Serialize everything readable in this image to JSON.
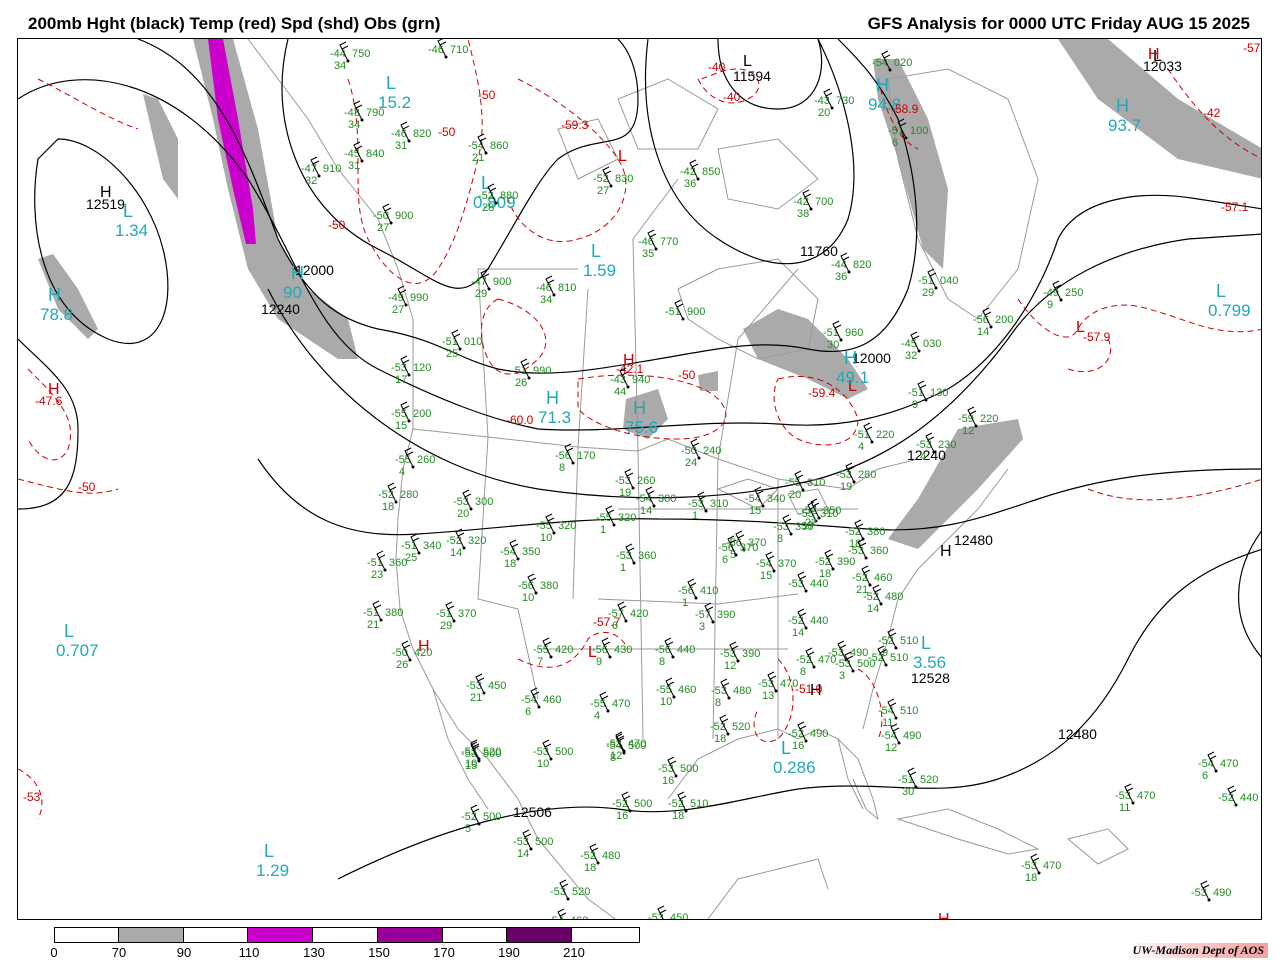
{
  "header": {
    "title_left": "200mb Hght (black) Temp (red) Spd (shd) Obs (grn)",
    "title_right": "GFS Analysis for 0000 UTC Friday  AUG 15 2025"
  },
  "colors": {
    "height_contour": "#000000",
    "temp_contour": "#cc0000",
    "obs": "#228b22",
    "speed_label": "#20a8b8",
    "geography": "#999999",
    "shade_70_90": "#aaaaaa",
    "shade_110_130": "#cc00cc",
    "shade_150_170": "#990099",
    "shade_190_210": "#660066"
  },
  "height_labels": [
    {
      "text": "12519"
    },
    {
      "text": "12000"
    },
    {
      "text": "12240"
    },
    {
      "text": "11594"
    },
    {
      "text": "11760"
    },
    {
      "text": "12000"
    },
    {
      "text": "12240"
    },
    {
      "text": "12480"
    },
    {
      "text": "12528"
    },
    {
      "text": "12480"
    },
    {
      "text": "12506"
    },
    {
      "text": "12033"
    }
  ],
  "center_markers": [
    {
      "letter": "H",
      "kind": "height"
    },
    {
      "letter": "L",
      "kind": "height"
    },
    {
      "letter": "H",
      "kind": "height"
    },
    {
      "letter": "L",
      "kind": "height"
    },
    {
      "letter": "H",
      "kind": "height"
    },
    {
      "letter": "H",
      "kind": "temp"
    },
    {
      "letter": "L",
      "kind": "temp"
    },
    {
      "letter": "H",
      "kind": "temp"
    },
    {
      "letter": "L",
      "kind": "temp"
    },
    {
      "letter": "H",
      "kind": "temp"
    },
    {
      "letter": "L",
      "kind": "temp"
    },
    {
      "letter": "H",
      "kind": "temp"
    },
    {
      "letter": "H",
      "kind": "temp"
    },
    {
      "letter": "L",
      "kind": "temp"
    }
  ],
  "speed_centers": [
    {
      "letter": "L",
      "value": "1.34"
    },
    {
      "letter": "H",
      "value": "78.8"
    },
    {
      "letter": "L",
      "value": "0.707"
    },
    {
      "letter": "L",
      "value": "1.29"
    },
    {
      "letter": "L",
      "value": "0.809"
    },
    {
      "letter": "L",
      "value": "1.59"
    },
    {
      "letter": "H",
      "value": "71.3"
    },
    {
      "letter": "H",
      "value": "75.6"
    },
    {
      "letter": "H",
      "value": "94.8"
    },
    {
      "letter": "H",
      "value": "93.7"
    },
    {
      "letter": "L",
      "value": "0.799"
    },
    {
      "letter": "H",
      "value": "49.1"
    },
    {
      "letter": "L",
      "value": "3.56"
    },
    {
      "letter": "L",
      "value": "0.286"
    },
    {
      "letter": "H",
      "value": "90"
    },
    {
      "letter": "L",
      "value": "15.2"
    }
  ],
  "temp_labels": [
    {
      "text": "-50"
    },
    {
      "text": "-50"
    },
    {
      "text": "-50"
    },
    {
      "text": "-50"
    },
    {
      "text": "-50"
    },
    {
      "text": "-40"
    },
    {
      "text": "-40"
    },
    {
      "text": "-59.3"
    },
    {
      "text": "-58.9"
    },
    {
      "text": "-57.1"
    },
    {
      "text": "-57.9"
    },
    {
      "text": "-59.4"
    },
    {
      "text": "-60.0"
    },
    {
      "text": "-42.1"
    },
    {
      "text": "-47.6"
    },
    {
      "text": "-57.7"
    },
    {
      "text": "-51.0"
    },
    {
      "text": "-57"
    },
    {
      "text": "-42"
    },
    {
      "text": "-53"
    }
  ],
  "observations": [
    {
      "t": "-44",
      "h": "750",
      "s": "34"
    },
    {
      "t": "-46",
      "h": "710",
      "s": ""
    },
    {
      "t": "-43",
      "h": "790",
      "s": "34"
    },
    {
      "t": "-46",
      "h": "820",
      "s": "31"
    },
    {
      "t": "-45",
      "h": "840",
      "s": "31"
    },
    {
      "t": "-47",
      "h": "910",
      "s": "32"
    },
    {
      "t": "-50",
      "h": "900",
      "s": "27"
    },
    {
      "t": "-54",
      "h": "860",
      "s": "21"
    },
    {
      "t": "-52",
      "h": "880",
      "s": "28"
    },
    {
      "t": "-52",
      "h": "830",
      "s": "27"
    },
    {
      "t": "-42",
      "h": "850",
      "s": "36"
    },
    {
      "t": "-43",
      "h": "730",
      "s": "20"
    },
    {
      "t": "-54",
      "h": "020",
      "s": ""
    },
    {
      "t": "-51",
      "h": "100",
      "s": "6"
    },
    {
      "t": "-42",
      "h": "700",
      "s": "38"
    },
    {
      "t": "-44",
      "h": "820",
      "s": "36"
    },
    {
      "t": "-46",
      "h": "770",
      "s": "35"
    },
    {
      "t": "-47",
      "h": "900",
      "s": "29"
    },
    {
      "t": "-46",
      "h": "810",
      "s": "34"
    },
    {
      "t": "-49",
      "h": "990",
      "s": "27"
    },
    {
      "t": "-51",
      "h": "010",
      "s": "25"
    },
    {
      "t": "-51",
      "h": "900",
      "s": ""
    },
    {
      "t": "-51",
      "h": "040",
      "s": "29"
    },
    {
      "t": "-49",
      "h": "250",
      "s": "9"
    },
    {
      "t": "-56",
      "h": "200",
      "s": "14"
    },
    {
      "t": "-51",
      "h": "960",
      "s": "30"
    },
    {
      "t": "-45",
      "h": "030",
      "s": "32"
    },
    {
      "t": "-53",
      "h": "120",
      "s": "17"
    },
    {
      "t": "-51",
      "h": "990",
      "s": "26"
    },
    {
      "t": "-43",
      "h": "940",
      "s": "44"
    },
    {
      "t": "-51",
      "h": "130",
      "s": "9"
    },
    {
      "t": "-55",
      "h": "200",
      "s": "15"
    },
    {
      "t": "-59",
      "h": "220",
      "s": "12"
    },
    {
      "t": "-55",
      "h": "260",
      "s": "4"
    },
    {
      "t": "-56",
      "h": "170",
      "s": "8"
    },
    {
      "t": "-50",
      "h": "240",
      "s": "24"
    },
    {
      "t": "-51",
      "h": "220",
      "s": "4"
    },
    {
      "t": "-53",
      "h": "230",
      "s": "4"
    },
    {
      "t": "-52",
      "h": "280",
      "s": "18"
    },
    {
      "t": "-53",
      "h": "300",
      "s": "20"
    },
    {
      "t": "-53",
      "h": "260",
      "s": "19"
    },
    {
      "t": "-54",
      "h": "300",
      "s": "14"
    },
    {
      "t": "-53",
      "h": "310",
      "s": "1"
    },
    {
      "t": "-54",
      "h": "340",
      "s": "15"
    },
    {
      "t": "-55",
      "h": "310",
      "s": "20"
    },
    {
      "t": "-53",
      "h": "280",
      "s": "19"
    },
    {
      "t": "-53",
      "h": "350",
      "s": "8"
    },
    {
      "t": "-53",
      "h": "310",
      "s": "17"
    },
    {
      "t": "-55",
      "h": "320",
      "s": "10"
    },
    {
      "t": "-55",
      "h": "320",
      "s": "1"
    },
    {
      "t": "-52",
      "h": "350",
      "s": "22"
    },
    {
      "t": "-52",
      "h": "380",
      "s": "18"
    },
    {
      "t": "-51",
      "h": "340",
      "s": "25"
    },
    {
      "t": "-52",
      "h": "320",
      "s": "14"
    },
    {
      "t": "-54",
      "h": "350",
      "s": "18"
    },
    {
      "t": "-51",
      "h": "360",
      "s": "23"
    },
    {
      "t": "-56",
      "h": "370",
      "s": "5"
    },
    {
      "t": "-53",
      "h": "360",
      "s": "1"
    },
    {
      "t": "-56",
      "h": "370",
      "s": "6"
    },
    {
      "t": "-54",
      "h": "370",
      "s": "15"
    },
    {
      "t": "-52",
      "h": "390",
      "s": "18"
    },
    {
      "t": "-52",
      "h": "460",
      "s": "21"
    },
    {
      "t": "-56",
      "h": "380",
      "s": "10"
    },
    {
      "t": "-56",
      "h": "410",
      "s": "1"
    },
    {
      "t": "-51",
      "h": "380",
      "s": "21"
    },
    {
      "t": "-51",
      "h": "370",
      "s": "29"
    },
    {
      "t": "-57",
      "h": "420",
      "s": "6"
    },
    {
      "t": "-57",
      "h": "390",
      "s": "3"
    },
    {
      "t": "-52",
      "h": "440",
      "s": "14"
    },
    {
      "t": "-52",
      "h": "480",
      "s": "14"
    },
    {
      "t": "-52",
      "h": "510",
      "s": "9"
    },
    {
      "t": "-52",
      "h": "510",
      "s": ""
    },
    {
      "t": "-50",
      "h": "420",
      "s": "26"
    },
    {
      "t": "-55",
      "h": "420",
      "s": "7"
    },
    {
      "t": "-56",
      "h": "430",
      "s": "9"
    },
    {
      "t": "-56",
      "h": "440",
      "s": "8"
    },
    {
      "t": "-53",
      "h": "390",
      "s": "12"
    },
    {
      "t": "-52",
      "h": "470",
      "s": "8"
    },
    {
      "t": "-53",
      "h": "490",
      "s": ""
    },
    {
      "t": "-53",
      "h": "450",
      "s": "21"
    },
    {
      "t": "-54",
      "h": "460",
      "s": "6"
    },
    {
      "t": "-55",
      "h": "470",
      "s": "4"
    },
    {
      "t": "-55",
      "h": "460",
      "s": "10"
    },
    {
      "t": "-53",
      "h": "480",
      "s": "8"
    },
    {
      "t": "-53",
      "h": "470",
      "s": "13"
    },
    {
      "t": "-52",
      "h": "520",
      "s": "18"
    },
    {
      "t": "-53",
      "h": "520",
      "s": "10"
    },
    {
      "t": "-53",
      "h": "470",
      "s": "12"
    },
    {
      "t": "-52",
      "h": "490",
      "s": "16"
    },
    {
      "t": "-53",
      "h": "500",
      "s": "3"
    },
    {
      "t": "-54",
      "h": "510",
      "s": "11"
    },
    {
      "t": "-54",
      "h": "490",
      "s": "12"
    },
    {
      "t": "-51",
      "h": "520",
      "s": "30"
    },
    {
      "t": "-53",
      "h": "500",
      "s": "15"
    },
    {
      "t": "-53",
      "h": "500",
      "s": "10"
    },
    {
      "t": "-54",
      "h": "500",
      "s": "8"
    },
    {
      "t": "-53",
      "h": "500",
      "s": "16"
    },
    {
      "t": "-52",
      "h": "500",
      "s": "16"
    },
    {
      "t": "-52",
      "h": "510",
      "s": "18"
    },
    {
      "t": "-52",
      "h": "500",
      "s": "5"
    },
    {
      "t": "-53",
      "h": "500",
      "s": "14"
    },
    {
      "t": "-52",
      "h": "480",
      "s": "18"
    },
    {
      "t": "-53",
      "h": "520",
      "s": ""
    },
    {
      "t": "-54",
      "h": "460",
      "s": ""
    },
    {
      "t": "-53",
      "h": "450",
      "s": "17"
    },
    {
      "t": "-53",
      "h": "470",
      "s": "18"
    },
    {
      "t": "-54",
      "h": "470",
      "s": "6"
    },
    {
      "t": "-53",
      "h": "470",
      "s": "11"
    },
    {
      "t": "-53",
      "h": "490",
      "s": ""
    },
    {
      "t": "-52",
      "h": "440",
      "s": ""
    },
    {
      "t": "-53",
      "h": "440",
      "s": ""
    },
    {
      "t": "-53",
      "h": "360",
      "s": ""
    }
  ],
  "colorbar": {
    "segments": [
      {
        "color": "#ffffff"
      },
      {
        "color": "#aaaaaa"
      },
      {
        "color": "#ffffff"
      },
      {
        "color": "#cc00cc"
      },
      {
        "color": "#ffffff"
      },
      {
        "color": "#990099"
      },
      {
        "color": "#ffffff"
      },
      {
        "color": "#660066"
      },
      {
        "color": "#ffffff"
      }
    ],
    "ticks": [
      "0",
      "70",
      "90",
      "110",
      "130",
      "150",
      "170",
      "190",
      "210"
    ]
  },
  "credit": "UW-Madison   Dept of AOS"
}
